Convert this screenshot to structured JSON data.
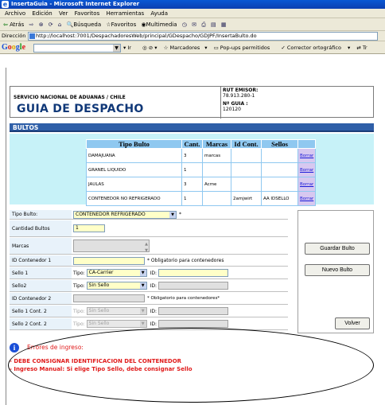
{
  "window": {
    "title": "InsertaGuia - Microsoft Internet Explorer"
  },
  "menu": [
    "Archivo",
    "Edición",
    "Ver",
    "Favoritos",
    "Herramientas",
    "Ayuda"
  ],
  "toolbar": {
    "back": "Atrás",
    "search": "Búsqueda",
    "favorites": "Favoritos",
    "multimedia": "Multimedia"
  },
  "address": {
    "label": "Dirección",
    "url": "http://localhost:7001/DespachadoresWeb/principal/GDespacho/GDJPF/InsertaBulto.do"
  },
  "google": {
    "go": "Ir",
    "bookmarks": "Marcadores",
    "popups": "Pop-ups permitidos",
    "spell": "Corrector ortográfico",
    "translate": "Tr"
  },
  "header": {
    "org": "SERVICIO NACIONAL DE ADUANAS / CHILE",
    "title": "GUIA DE DESPACHO",
    "rut_label": "RUT EMISOR:",
    "rut_value": "78.913.280-1",
    "guia_label": "Nº GUIA :",
    "guia_value": "120120"
  },
  "section": {
    "bultos": "BULTOS"
  },
  "bultos_table": {
    "headers": [
      "Tipo Bulto",
      "Cant.",
      "Marcas",
      "Id Cont.",
      "Sellos"
    ],
    "rows": [
      {
        "tipo": "DAMAJUANA",
        "cant": "3",
        "marcas": "marcas",
        "idcont": "",
        "sellos": "",
        "action": "Borrar"
      },
      {
        "tipo": "GRANEL LIQUIDO",
        "cant": "1",
        "marcas": "",
        "idcont": "",
        "sellos": "",
        "action": "Borrar"
      },
      {
        "tipo": "JAULAS",
        "cant": "3",
        "marcas": "Acme",
        "idcont": "",
        "sellos": "",
        "action": "Borrar"
      },
      {
        "tipo": "CONTENEDOR NO REFRIGERADO",
        "cant": "1",
        "marcas": "",
        "idcont": "2amjwirt",
        "sellos": "AA IDSELLO",
        "action": "Borrar"
      }
    ]
  },
  "form": {
    "tipo_bulto_label": "Tipo Bulto:",
    "tipo_bulto_value": "CONTENEDOR REFRIGERADO",
    "required_mark": "*",
    "cantidad_label": "Cantidad Bultos",
    "cantidad_value": "1",
    "marcas_label": "Marcas",
    "id_cont1_label": "ID Contenedor 1",
    "id_cont1_note": "* Obligatorio para contenedores",
    "sello1_label": "Sello 1",
    "tipo_label": "Tipo:",
    "id_label": "ID:",
    "sello1_tipo": "CA-Carrier",
    "sello2_label": "Sello2",
    "sello2_tipo": "Sin Sello",
    "id_cont2_label": "ID Contenedor 2",
    "id_cont2_note": "* Obligatorio para contenedores*",
    "sello1c2_label": "Sello 1 Cont. 2",
    "sello1c2_tipo": "Sin Sello",
    "sello2c2_label": "Sello 2 Cont. 2",
    "sello2c2_tipo": "Sin Sello"
  },
  "buttons": {
    "guardar": "Guardar Bulto",
    "nuevo": "Nuevo Bulto",
    "volver": "Volver"
  },
  "errors": {
    "title": "Errores de ingreso:",
    "items": [
      "- DEBE CONSIGNAR IDENTIFICACION DEL CONTENEDOR",
      "- Ingreso Manual: Si elige Tipo Sello, debe consignar Sello"
    ]
  },
  "colors": {
    "section_bar": "#2f5fa8",
    "table_panel": "#c7f2f8",
    "error_text": "#e01a1a",
    "title_text": "#103878"
  }
}
